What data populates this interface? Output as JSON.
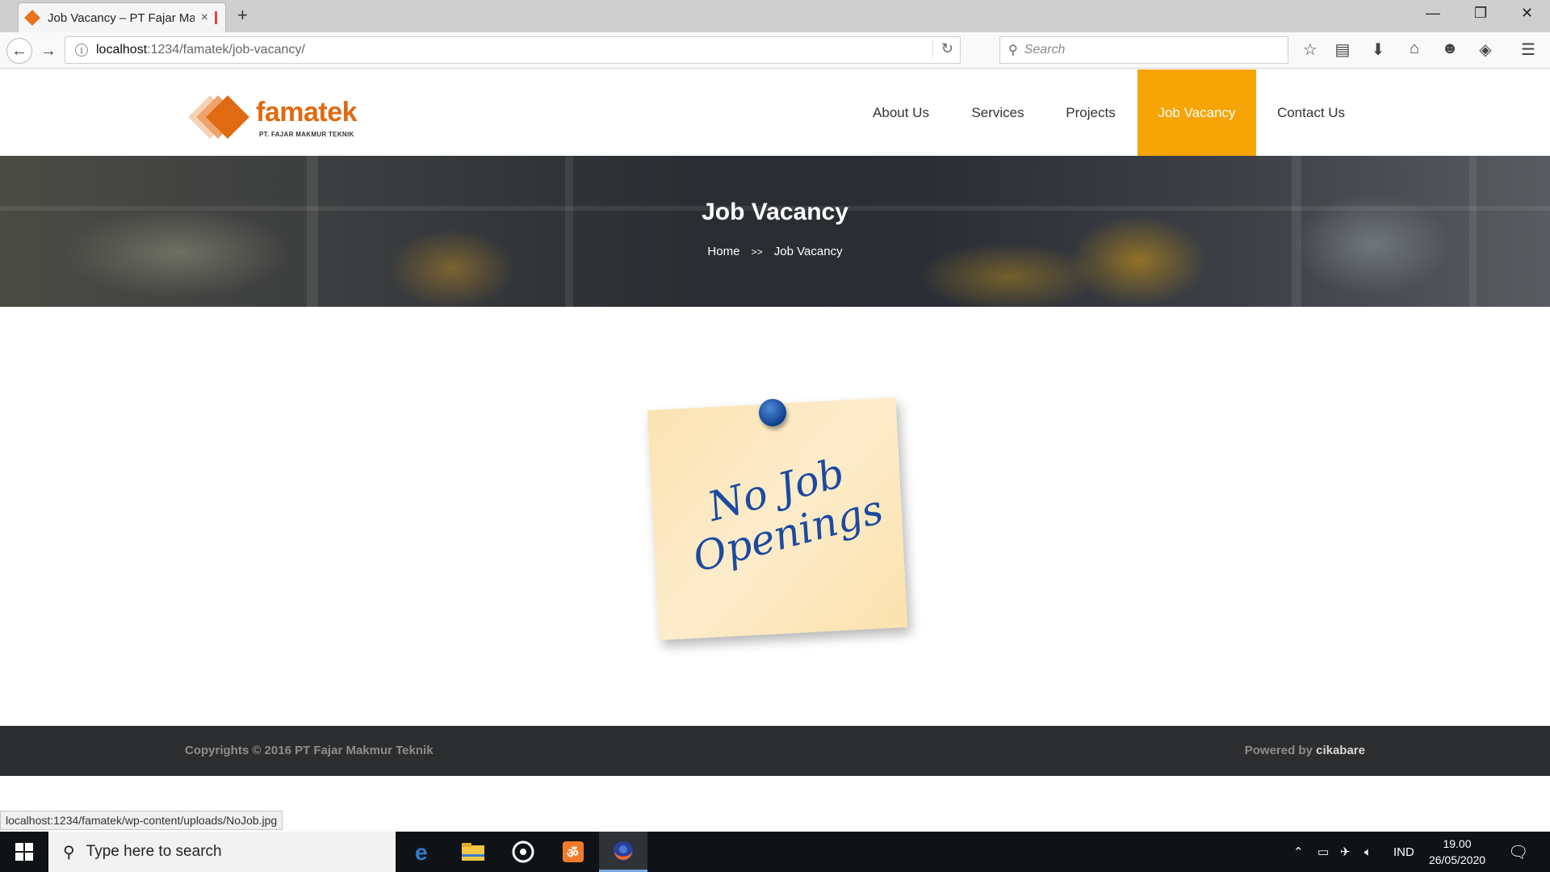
{
  "browser": {
    "tab_title": "Job Vacancy – PT Fajar Ma...",
    "tab_close": "×",
    "new_tab": "+",
    "url_host": "localhost",
    "url_path": ":1234/famatek/job-vacancy/",
    "search_placeholder": "Search",
    "window_controls": {
      "minimize": "—",
      "restore": "❐",
      "close": "✕"
    },
    "toolbar_icons": [
      "star-icon",
      "reading-list-icon",
      "download-icon",
      "home-icon",
      "chat-icon",
      "pocket-icon",
      "menu-icon"
    ]
  },
  "site": {
    "logo": {
      "name": "famatek",
      "tagline": "PT. FAJAR MAKMUR TEKNIK"
    },
    "menu": [
      {
        "label": "About Us"
      },
      {
        "label": "Services"
      },
      {
        "label": "Projects"
      },
      {
        "label": "Job Vacancy",
        "active": true
      },
      {
        "label": "Contact Us"
      }
    ],
    "accent_color": "#f7a407",
    "hero": {
      "title": "Job Vacancy",
      "breadcrumb": {
        "home": "Home",
        "separator": ">>",
        "current": "Job Vacancy"
      }
    },
    "note": {
      "line1": "No Job",
      "line2": "Openings"
    },
    "footer": {
      "copyright": "Copyrights © 2016 PT Fajar Makmur Teknik",
      "powered_prefix": "Powered by",
      "powered_by": "cikabare"
    }
  },
  "status_url": "localhost:1234/famatek/wp-content/uploads/NoJob.jpg",
  "taskbar": {
    "search_placeholder": "Type here to search",
    "apps": [
      "edge-icon",
      "file-explorer-icon",
      "media-icon",
      "xampp-icon",
      "firefox-icon"
    ],
    "tray": {
      "language": "IND",
      "time": "19.00",
      "date": "26/05/2020"
    }
  }
}
